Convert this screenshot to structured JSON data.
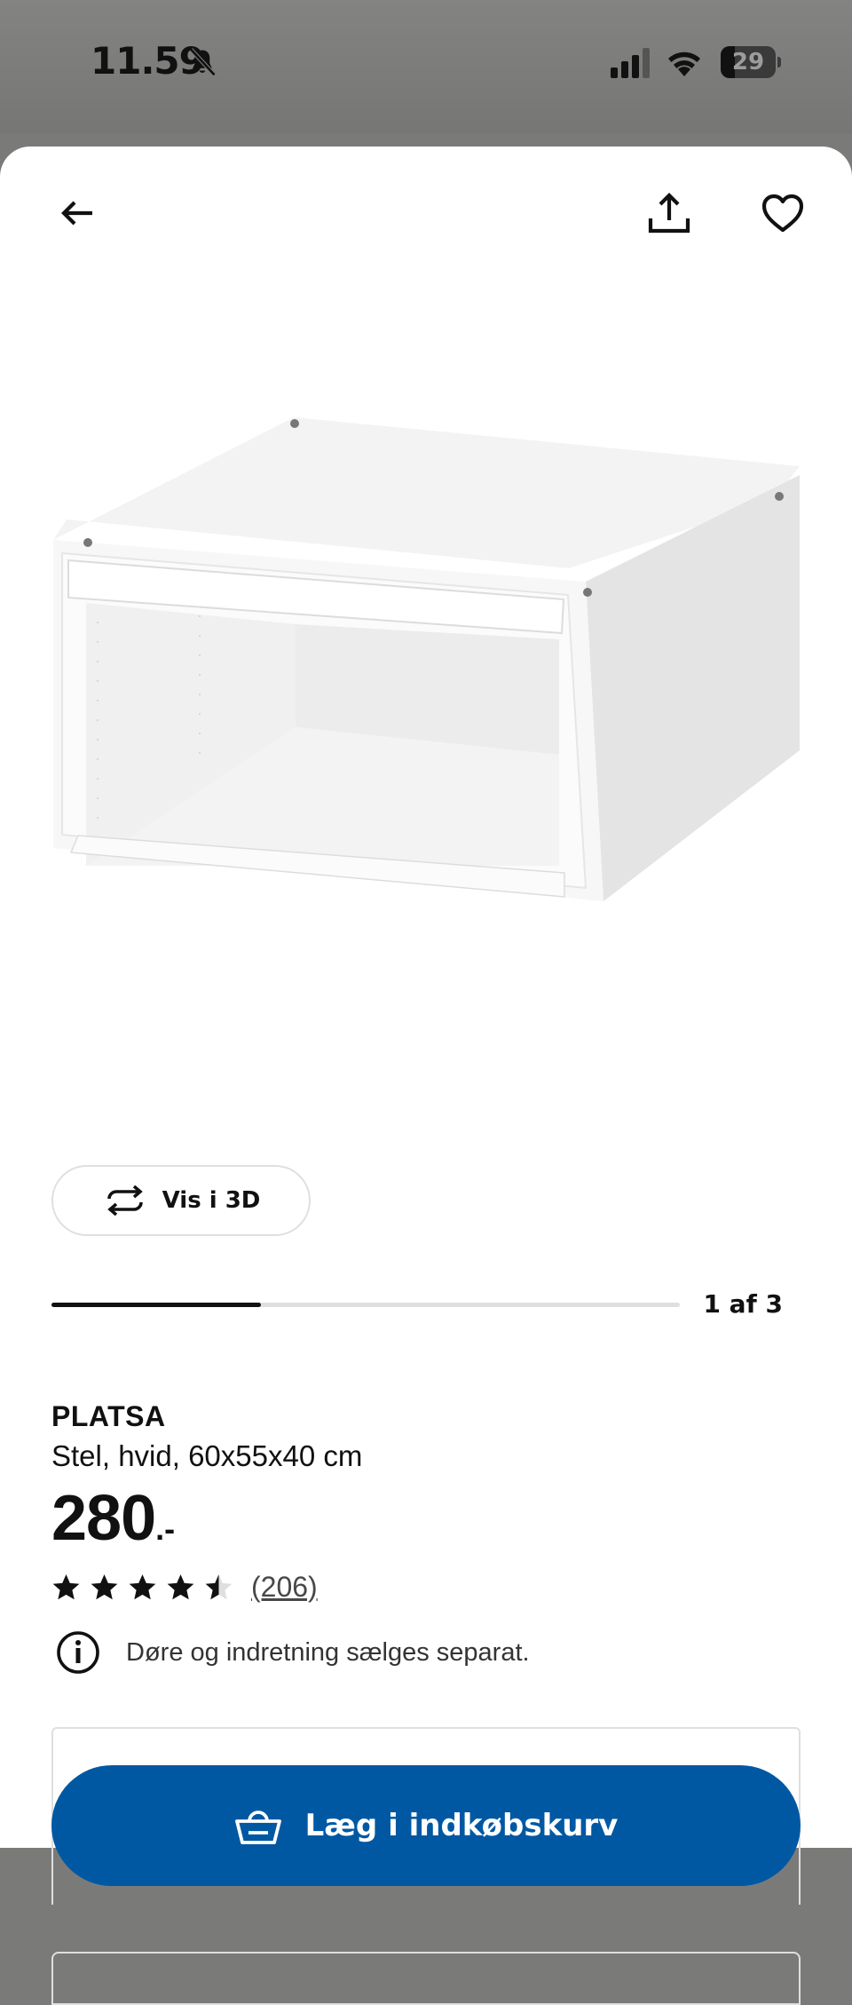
{
  "status_bar": {
    "time": "11.59",
    "battery": "29",
    "icons": [
      "bell-slash-icon",
      "cellular-signal-icon",
      "wifi-icon",
      "battery-icon"
    ]
  },
  "header": {
    "icons": [
      "arrow-left-icon",
      "share-icon",
      "heart-icon"
    ]
  },
  "gallery": {
    "view_3d_label": "Vis i 3D",
    "view_3d_icon": "rotate-icon",
    "counter": "1 af 3",
    "progress_fraction": 0.333
  },
  "product": {
    "name": "PLATSA",
    "description": "Stel, hvid, 60x55x40 cm",
    "price": "280",
    "price_suffix": ".-",
    "rating_value": 4.5,
    "rating_max": 5,
    "review_count": "(206)",
    "notice_icon": "info-icon",
    "notice": "Døre og indretning sælges separat."
  },
  "actions": {
    "add_to_cart_label": "Læg i indkøbskurv",
    "add_to_cart_icon": "basket-icon"
  },
  "colors": {
    "primary_button": "#0058a3",
    "text": "#111111",
    "border": "#dfdfdf"
  }
}
